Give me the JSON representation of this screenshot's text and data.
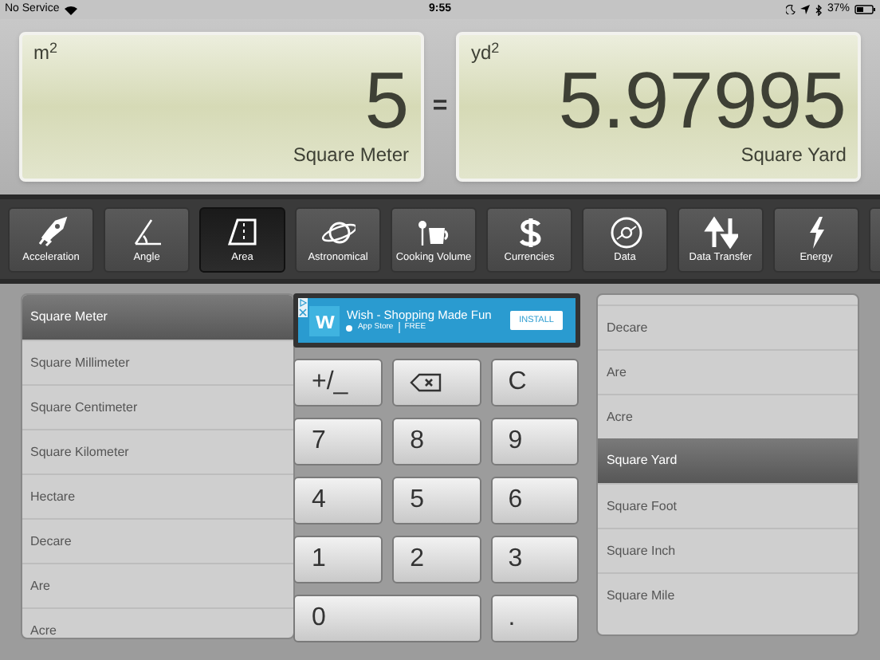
{
  "status_bar": {
    "carrier": "No Service",
    "time": "9:55",
    "battery": "37%"
  },
  "displays": [
    {
      "unit": "m$^{2}$",
      "value": "5",
      "name": "Square Meter"
    },
    {
      "unit": "yd$^{2}$",
      "value": "5.97995",
      "name": "Square Yard"
    }
  ],
  "equals": "=",
  "categories": [
    {
      "label": "Acceleration",
      "selected": false
    },
    {
      "label": "Angle",
      "selected": false
    },
    {
      "label": "Area",
      "selected": true
    },
    {
      "label": "Astronomical",
      "selected": false
    },
    {
      "label": "Cooking Volume",
      "selected": false
    },
    {
      "label": "Currencies",
      "selected": false
    },
    {
      "label": "Data",
      "selected": false
    },
    {
      "label": "Data Transfer",
      "selected": false
    },
    {
      "label": "Energy",
      "selected": false
    }
  ],
  "from_units": [
    {
      "label": "Square Meter",
      "selected": true
    },
    {
      "label": "Square Millimeter",
      "selected": false
    },
    {
      "label": "Square Centimeter",
      "selected": false
    },
    {
      "label": "Square Kilometer",
      "selected": false
    },
    {
      "label": "Hectare",
      "selected": false
    },
    {
      "label": "Decare",
      "selected": false
    },
    {
      "label": "Are",
      "selected": false
    },
    {
      "label": "Acre",
      "selected": false
    }
  ],
  "ad": {
    "logo": "w",
    "title": "Wish - Shopping Made Fun",
    "store": "App Store",
    "price": "FREE",
    "button": "INSTALL"
  },
  "keys": [
    {
      "kind": "text",
      "label": "+/_"
    },
    {
      "kind": "backspace"
    },
    {
      "kind": "text",
      "label": "C"
    },
    {
      "kind": "text",
      "label": "7"
    },
    {
      "kind": "text",
      "label": "8"
    },
    {
      "kind": "text",
      "label": "9"
    },
    {
      "kind": "text",
      "label": "4"
    },
    {
      "kind": "text",
      "label": "5"
    },
    {
      "kind": "text",
      "label": "6"
    },
    {
      "kind": "text",
      "label": "1"
    },
    {
      "kind": "text",
      "label": "2"
    },
    {
      "kind": "text",
      "label": "3"
    },
    {
      "kind": "wide",
      "label": "0"
    },
    {
      "kind": "text",
      "label": "."
    }
  ],
  "to_units": [
    {
      "label": "Decare",
      "selected": false
    },
    {
      "label": "Are",
      "selected": false
    },
    {
      "label": "Acre",
      "selected": false
    },
    {
      "label": "Square Yard",
      "selected": true
    },
    {
      "label": "Square Foot",
      "selected": false
    },
    {
      "label": "Square Inch",
      "selected": false
    },
    {
      "label": "Square Mile",
      "selected": false
    }
  ]
}
